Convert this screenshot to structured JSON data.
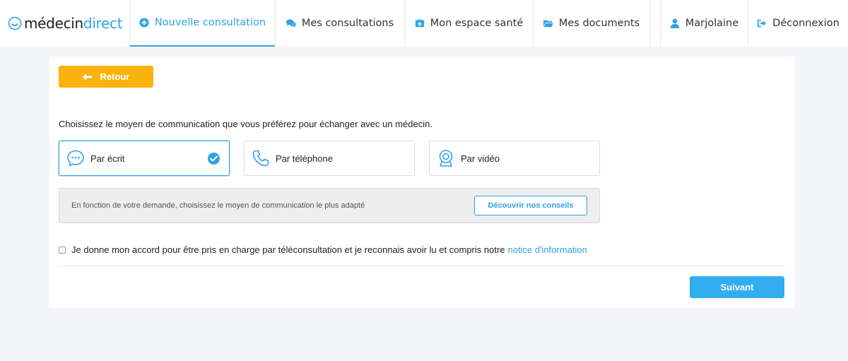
{
  "logo": {
    "part1": "médecin",
    "part2": "direct"
  },
  "nav": {
    "new_consultation": "Nouvelle consultation",
    "my_consultations": "Mes consultations",
    "health_space": "Mon espace santé",
    "documents": "Mes documents",
    "user": "Marjolaine",
    "logout": "Déconnexion"
  },
  "back_label": "Retour",
  "question": "Choisissez le moyen de communication que vous préférez pour échanger avec un médecin.",
  "options": [
    {
      "label": "Par écrit",
      "icon": "chat-bubble-icon",
      "selected": true
    },
    {
      "label": "Par téléphone",
      "icon": "phone-icon",
      "selected": false
    },
    {
      "label": "Par vidéo",
      "icon": "webcam-icon",
      "selected": false
    }
  ],
  "advice": {
    "text": "En fonction de votre demande, choisissez le moyen de communication le plus adapté",
    "button": "Découvrir nos conseils"
  },
  "consent": {
    "text": "Je donne mon accord pour être pris en charge par téléconsultation et je reconnais avoir lu et compris notre",
    "link": "notice d'information",
    "checked": false
  },
  "next_label": "Suivant",
  "colors": {
    "accent": "#2fa3e6",
    "back_button": "#fbb20f",
    "next_button": "#33adf2"
  }
}
